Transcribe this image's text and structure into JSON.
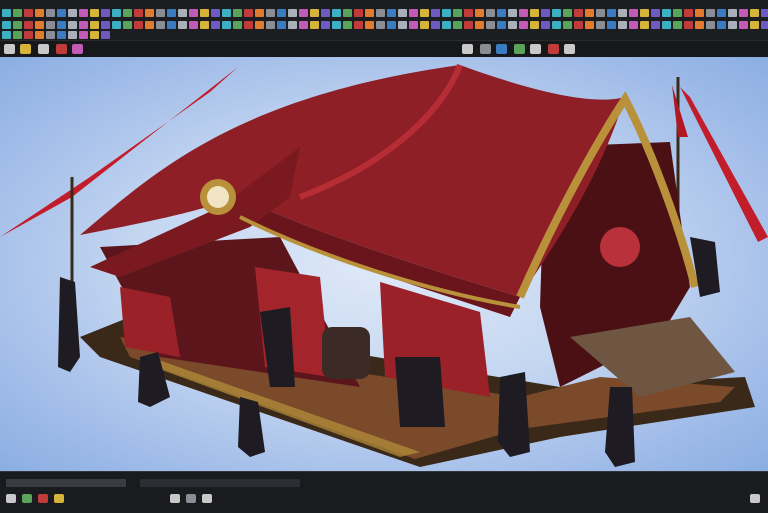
{
  "app": {
    "name": ""
  },
  "toolbar": {
    "icon_colors": [
      "#c23b3b",
      "#3b7bc2",
      "#d6b43a",
      "#5aa35a",
      "#8a8d93",
      "#c25bb5",
      "#3bb0c2",
      "#e07b30",
      "#aab0ba",
      "#6d5bc2"
    ],
    "row2_icons": [
      "select-icon",
      "move-icon",
      "rotate-icon",
      "scale-icon",
      "snap-icon",
      "mesh-icon",
      "camera-icon",
      "render-icon",
      "texture-icon",
      "light-icon",
      "home-icon"
    ]
  },
  "scene": {
    "subject": "red-carnival-tent-3d-model",
    "colors": {
      "canvas_top": "#dfe9f8",
      "canvas_edge": "#8aaee2",
      "tent_red": "#8e1f26",
      "tent_dark": "#4a1014",
      "gold_trim": "#b8913a",
      "wood": "#5a3b24"
    }
  },
  "status": {
    "text": ""
  }
}
